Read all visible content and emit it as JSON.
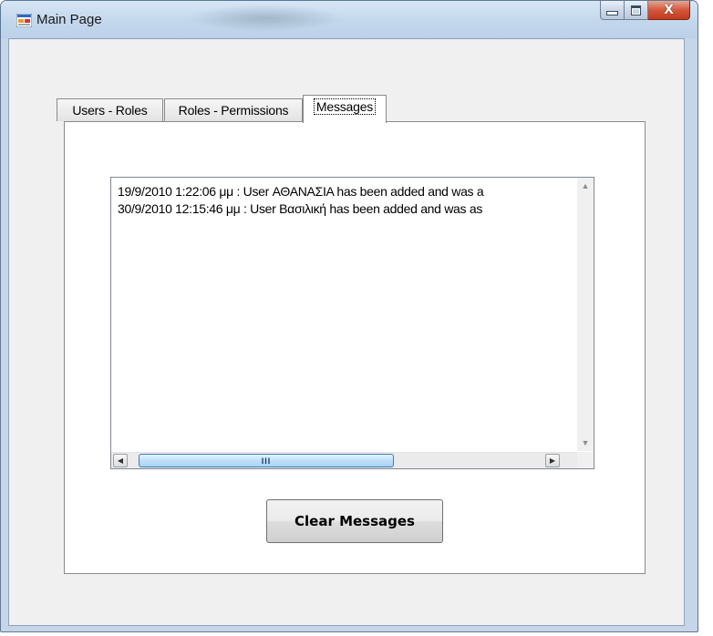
{
  "window": {
    "title": "Main Page",
    "icons": {
      "app": "windows-form-icon",
      "minimize": "minimize-icon",
      "maximize": "maximize-icon",
      "close": "close-icon"
    },
    "close_glyph": "X"
  },
  "tabs": [
    {
      "label": "Users - Roles",
      "selected": false
    },
    {
      "label": "Roles - Permissions",
      "selected": false
    },
    {
      "label": "Messages",
      "selected": true
    }
  ],
  "messages": {
    "lines": [
      "19/9/2010 1:22:06 μμ  :  User ΑΘΑΝΑΣΙΑ has been added and was a",
      "30/9/2010 12:15:46 μμ  :  User Βασιλική has been added and was as"
    ],
    "scroll": {
      "up_icon": "scroll-up-icon",
      "down_icon": "scroll-down-icon",
      "left_icon": "scroll-left-icon",
      "right_icon": "scroll-right-icon",
      "grip": "III"
    }
  },
  "buttons": {
    "clear_label": "Clear Messages"
  },
  "colors": {
    "titlebar": "#c3d7ec",
    "close_button": "#c4391d",
    "thumb": "#bee0f8"
  }
}
